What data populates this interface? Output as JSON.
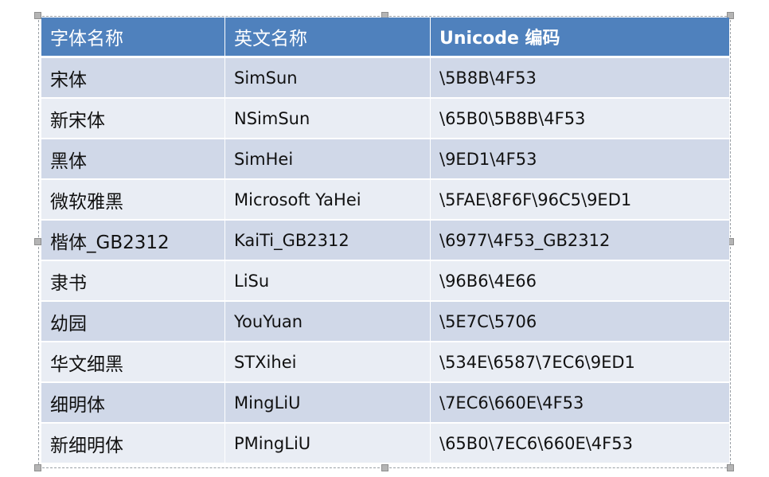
{
  "table": {
    "headers": [
      "字体名称",
      "英文名称",
      "Unicode 编码"
    ],
    "rows": [
      {
        "cn": "宋体",
        "en": "SimSun",
        "code": "\\5B8B\\4F53"
      },
      {
        "cn": "新宋体",
        "en": "NSimSun",
        "code": "\\65B0\\5B8B\\4F53"
      },
      {
        "cn": "黑体",
        "en": "SimHei",
        "code": "\\9ED1\\4F53"
      },
      {
        "cn": "微软雅黑",
        "en": "Microsoft YaHei",
        "code": "\\5FAE\\8F6F\\96C5\\9ED1"
      },
      {
        "cn": "楷体_GB2312",
        "en": "KaiTi_GB2312",
        "code": "\\6977\\4F53_GB2312"
      },
      {
        "cn": "隶书",
        "en": "LiSu",
        "code": "\\96B6\\4E66"
      },
      {
        "cn": "幼园",
        "en": "YouYuan",
        "code": "\\5E7C\\5706"
      },
      {
        "cn": "华文细黑",
        "en": "STXihei",
        "code": "\\534E\\6587\\7EC6\\9ED1"
      },
      {
        "cn": "细明体",
        "en": "MingLiU",
        "code": "\\7EC6\\660E\\4F53"
      },
      {
        "cn": "新细明体",
        "en": "PMingLiU",
        "code": "\\65B0\\7EC6\\660E\\4F53"
      }
    ]
  },
  "colors": {
    "header_bg": "#4f81bd",
    "row_odd_bg": "#d0d8e8",
    "row_even_bg": "#e9edf4"
  }
}
